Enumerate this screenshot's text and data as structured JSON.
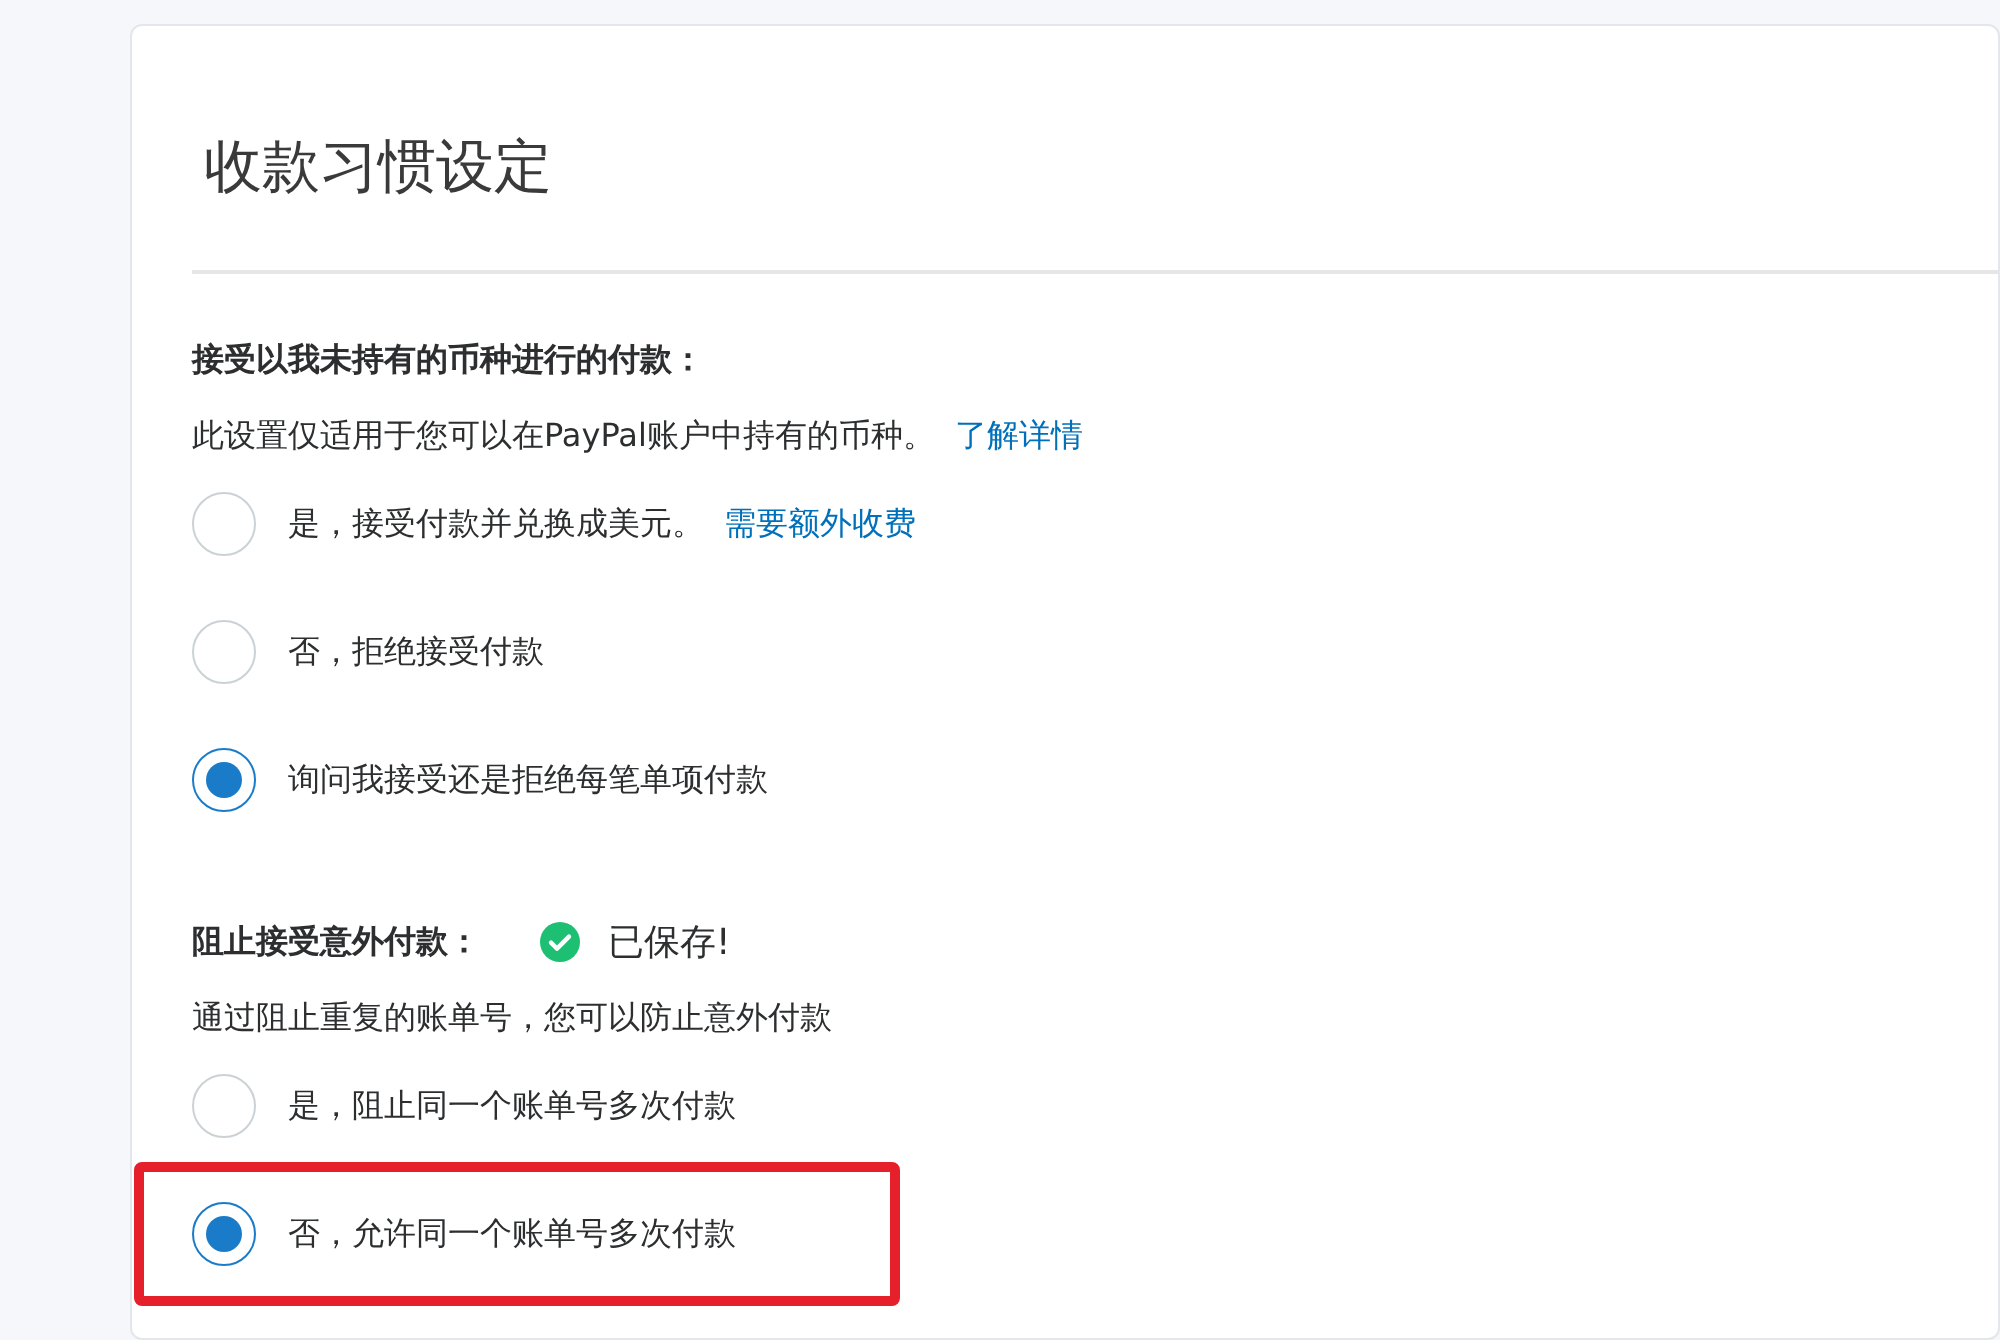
{
  "page": {
    "title": "收款习惯设定"
  },
  "sections": [
    {
      "heading": "接受以我未持有的币种进行的付款：",
      "description": "此设置仅适用于您可以在PayPal账户中持有的币种。",
      "description_link": "了解详情",
      "options": [
        {
          "label": "是，接受付款并兑换成美元。",
          "link": "需要额外收费",
          "selected": false,
          "highlighted": false
        },
        {
          "label": "否，拒绝接受付款",
          "selected": false,
          "highlighted": false
        },
        {
          "label": "询问我接受还是拒绝每笔单项付款",
          "selected": true,
          "highlighted": false
        }
      ]
    },
    {
      "heading": "阻止接受意外付款：",
      "status": "已保存!",
      "description": "通过阻止重复的账单号，您可以防止意外付款",
      "options": [
        {
          "label": "是，阻止同一个账单号多次付款",
          "selected": false,
          "highlighted": false
        },
        {
          "label": "否，允许同一个账单号多次付款",
          "selected": true,
          "highlighted": true
        }
      ]
    }
  ]
}
